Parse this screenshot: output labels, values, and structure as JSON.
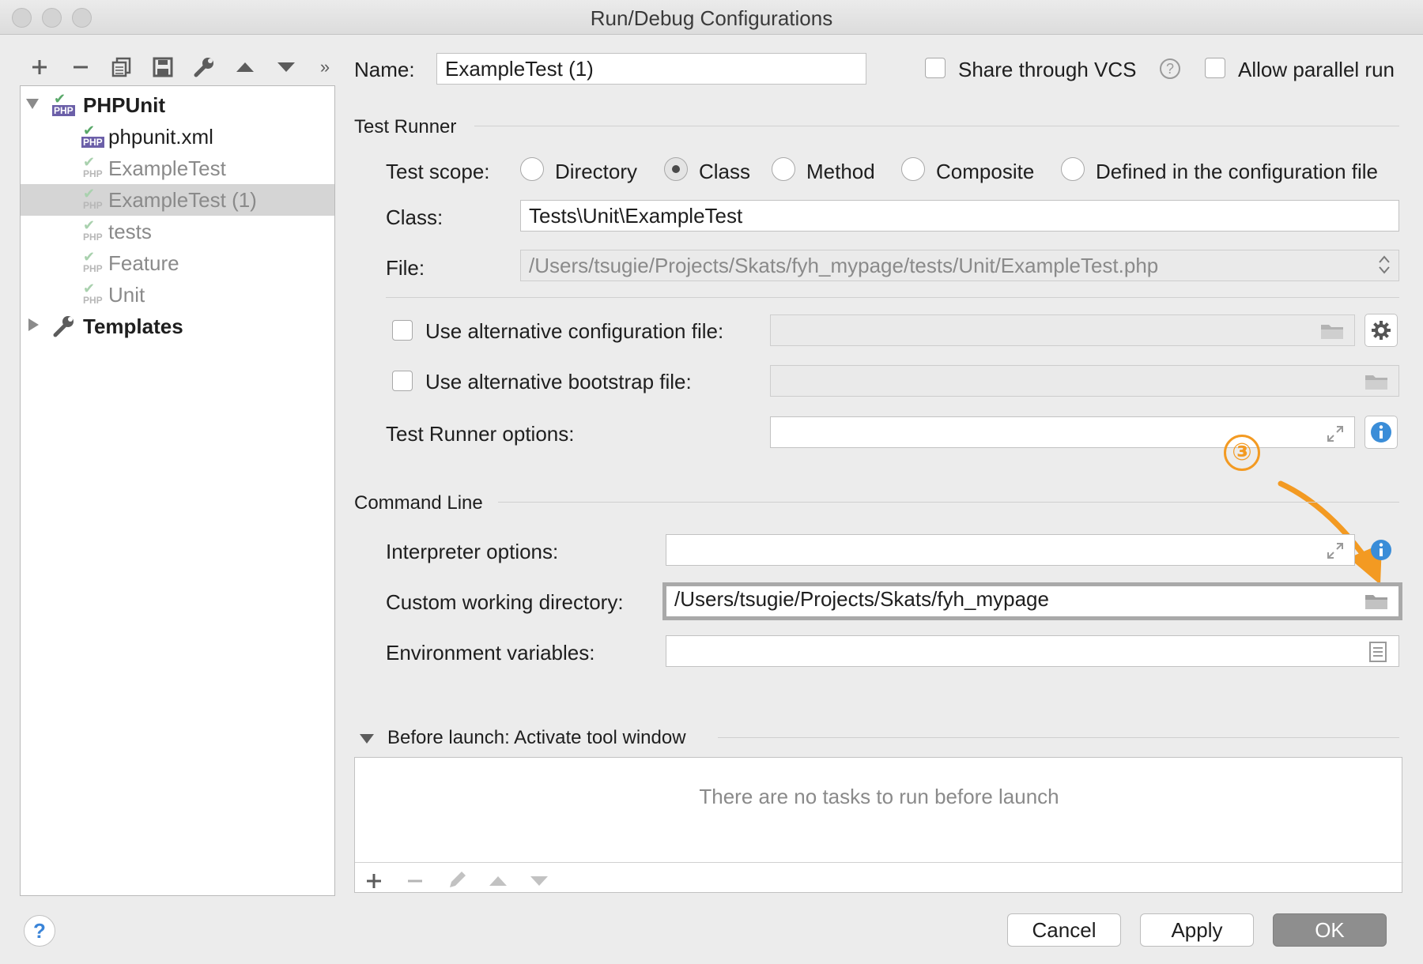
{
  "window": {
    "title": "Run/Debug Configurations"
  },
  "toolbar": {
    "icons": [
      "plus-icon",
      "minus-icon",
      "copy-icon",
      "save-icon",
      "wrench-icon",
      "arrow-up-icon",
      "arrow-down-icon",
      "more-icon"
    ]
  },
  "tree": {
    "items": [
      {
        "label": "PHPUnit",
        "bold": true
      },
      {
        "label": "phpunit.xml"
      },
      {
        "label": "ExampleTest"
      },
      {
        "label": "ExampleTest (1)",
        "selected": true
      },
      {
        "label": "tests"
      },
      {
        "label": "Feature"
      },
      {
        "label": "Unit"
      },
      {
        "label": "Templates",
        "bold": true
      }
    ],
    "php_badge": "PHP"
  },
  "header": {
    "name_label": "Name:",
    "name_value": "ExampleTest (1)",
    "share_label": "Share through VCS",
    "help_glyph": "?",
    "parallel_label": "Allow parallel run"
  },
  "test_runner": {
    "section_title": "Test Runner",
    "scope_label": "Test scope:",
    "scopes": [
      "Directory",
      "Class",
      "Method",
      "Composite",
      "Defined in the configuration file"
    ],
    "selected_scope": "Class",
    "class_label": "Class:",
    "class_value": "Tests\\Unit\\ExampleTest",
    "file_label": "File:",
    "file_value": "/Users/tsugie/Projects/Skats/fyh_mypage/tests/Unit/ExampleTest.php",
    "alt_config_label": "Use alternative configuration file:",
    "alt_bootstrap_label": "Use alternative bootstrap file:",
    "runner_options_label": "Test Runner options:"
  },
  "command_line": {
    "section_title": "Command Line",
    "interpreter_label": "Interpreter options:",
    "workdir_label": "Custom working directory:",
    "workdir_value": "/Users/tsugie/Projects/Skats/fyh_mypage",
    "env_label": "Environment variables:"
  },
  "before_launch": {
    "title": "Before launch: Activate tool window",
    "empty_text": "There are no tasks to run before launch"
  },
  "annotation": {
    "step": "③",
    "color": "#f39a22"
  },
  "footer": {
    "help": "?",
    "cancel": "Cancel",
    "apply": "Apply",
    "ok": "OK"
  }
}
